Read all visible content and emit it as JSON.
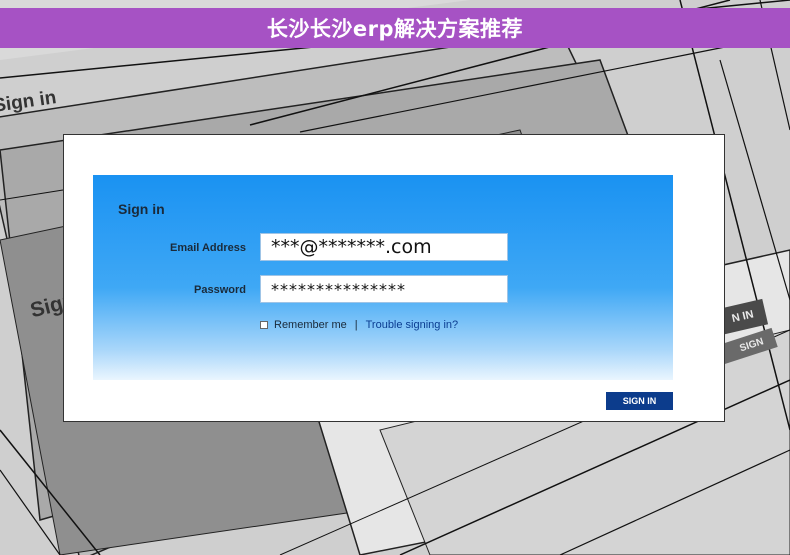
{
  "banner": {
    "title": "长沙长沙erp解决方案推荐"
  },
  "background": {
    "sign_in_text_1": "Sign in",
    "sign_in_text_2": "Sign",
    "button_text_1": "N IN",
    "button_text_2": "SIGN"
  },
  "form": {
    "title": "Sign in",
    "email_label": "Email Address",
    "email_value": "***@*******.com",
    "password_label": "Password",
    "password_value": "***************",
    "remember_label": "Remember me",
    "separator": "|",
    "trouble_link": "Trouble signing in?",
    "submit_label": "SIGN IN"
  },
  "colors": {
    "banner": "#a652c4",
    "panel_top": "#1a92f2",
    "submit": "#0c3c8c",
    "link": "#0b3d91"
  }
}
